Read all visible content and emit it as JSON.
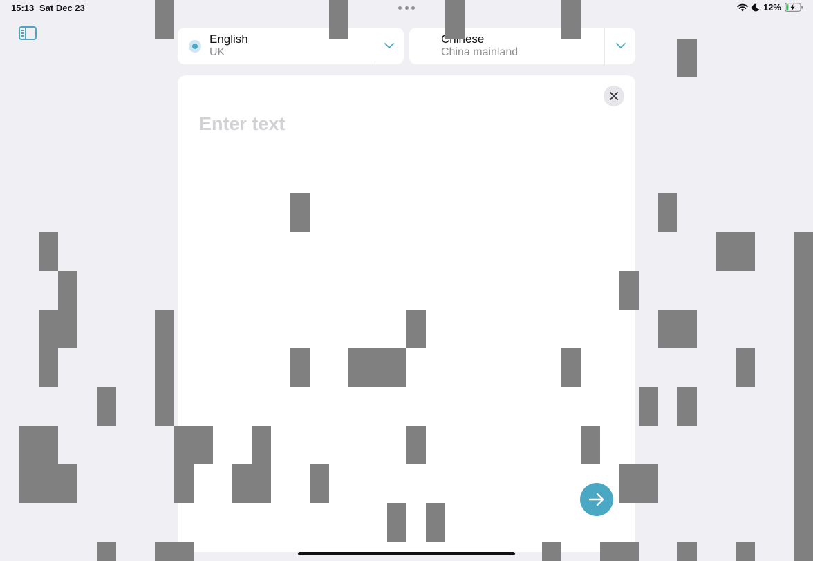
{
  "status_bar": {
    "time": "15:13",
    "date": "Sat Dec 23",
    "battery": "12%",
    "icons": [
      "wifi-icon",
      "moon-icon",
      "battery-charging-icon"
    ]
  },
  "toolbar": {
    "sidebar_icon": "sidebar-icon"
  },
  "source_language": {
    "name": "English",
    "region": "UK",
    "chevron_icon": "chevron-down-icon"
  },
  "target_language": {
    "name": "Chinese",
    "region": "China mainland",
    "chevron_icon": "chevron-down-icon"
  },
  "input": {
    "placeholder": "Enter text",
    "value": "",
    "clear_icon": "close-icon",
    "submit_icon": "arrow-right-icon"
  },
  "colors": {
    "background": "#F0EFF4",
    "accent": "#4AA8C4",
    "card": "#FFFFFF",
    "secondary_text": "#8E8E93",
    "placeholder": "#D1D1D6",
    "redaction": "#808080"
  }
}
